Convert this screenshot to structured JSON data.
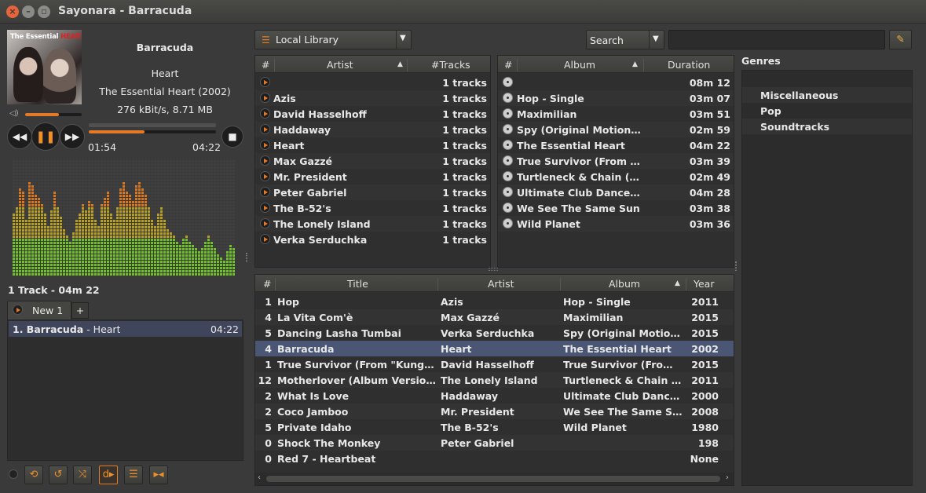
{
  "window": {
    "title": "Sayonara - Barracuda"
  },
  "now_playing": {
    "title": "Barracuda",
    "artist": "Heart",
    "album": "The Essential Heart (2002)",
    "bitrate": "276 kBit/s, 8.71 MB",
    "cover_text": "The Essential",
    "cover_brand": "HEART",
    "elapsed": "01:54",
    "duration": "04:22",
    "progress": 0.44,
    "volume": 0.6
  },
  "playlist": {
    "summary": "1 Track - 04m 22",
    "tab_label": "New 1",
    "add_tab": "+",
    "items": [
      {
        "title": "1. Barracuda",
        "artist": " - Heart",
        "time": "04:22"
      }
    ]
  },
  "library": {
    "source": "Local Library",
    "search_mode": "Search",
    "search_value": "",
    "artist_headers": {
      "num": "#",
      "artist": "Artist",
      "tracks": "#Tracks"
    },
    "artists": [
      {
        "name": "",
        "tracks": "1 tracks"
      },
      {
        "name": "Azis",
        "tracks": "1 tracks"
      },
      {
        "name": "David Hasselhoff",
        "tracks": "1 tracks"
      },
      {
        "name": "Haddaway",
        "tracks": "1 tracks"
      },
      {
        "name": "Heart",
        "tracks": "1 tracks"
      },
      {
        "name": "Max Gazzé",
        "tracks": "1 tracks"
      },
      {
        "name": "Mr. President",
        "tracks": "1 tracks"
      },
      {
        "name": "Peter Gabriel",
        "tracks": "1 tracks"
      },
      {
        "name": "The B-52's",
        "tracks": "1 tracks"
      },
      {
        "name": "The Lonely Island",
        "tracks": "1 tracks"
      },
      {
        "name": "Verka Serduchka",
        "tracks": "1 tracks"
      }
    ],
    "album_headers": {
      "num": "#",
      "album": "Album",
      "duration": "Duration"
    },
    "albums": [
      {
        "name": "",
        "duration": "08m 12"
      },
      {
        "name": "Hop - Single",
        "duration": "03m 07"
      },
      {
        "name": "Maximilian",
        "duration": "03m 51"
      },
      {
        "name": "Spy (Original Motion P...",
        "duration": "02m 59"
      },
      {
        "name": "The Essential Heart",
        "duration": "04m 22"
      },
      {
        "name": "True Survivor (From \"K...",
        "duration": "03m 39"
      },
      {
        "name": "Turtleneck & Chain (Ex...",
        "duration": "02m 49"
      },
      {
        "name": "Ultimate Club Dance 9...",
        "duration": "04m 28"
      },
      {
        "name": "We See The Same Sun",
        "duration": "03m 38"
      },
      {
        "name": "Wild Planet",
        "duration": "03m 36"
      }
    ],
    "genres_title": "Genres",
    "genres": [
      "Miscellaneous",
      "Pop",
      "Soundtracks"
    ],
    "track_headers": {
      "num": "#",
      "title": "Title",
      "artist": "Artist",
      "album": "Album",
      "year": "Year"
    },
    "tracks": [
      {
        "num": "1",
        "title": "Hop",
        "artist": "Azis",
        "album": "Hop - Single",
        "year": "2011"
      },
      {
        "num": "4",
        "title": "La Vita Com'è",
        "artist": "Max Gazzé",
        "album": "Maximilian",
        "year": "2015"
      },
      {
        "num": "5",
        "title": "Dancing Lasha Tumbai",
        "artist": "Verka Serduchka",
        "album": "Spy (Original Motion ...",
        "year": "2015"
      },
      {
        "num": "4",
        "title": "Barracuda",
        "artist": "Heart",
        "album": "The Essential Heart",
        "year": "2002"
      },
      {
        "num": "1",
        "title": "True Survivor (From \"Kung Fur...",
        "artist": "David Hasselhoff",
        "album": "True Survivor (From \"...",
        "year": "2015"
      },
      {
        "num": "12",
        "title": "Motherlover (Album Version) [...",
        "artist": "The Lonely Island",
        "album": "Turtleneck & Chain (E...",
        "year": "2011"
      },
      {
        "num": "2",
        "title": "What Is Love",
        "artist": "Haddaway",
        "album": "Ultimate Club Dance ...",
        "year": "2000"
      },
      {
        "num": "2",
        "title": "Coco Jamboo",
        "artist": "Mr. President",
        "album": "We See The Same Sun",
        "year": "2008"
      },
      {
        "num": "5",
        "title": "Private Idaho",
        "artist": "The B-52's",
        "album": "Wild Planet",
        "year": "1980"
      },
      {
        "num": "0",
        "title": "Shock The Monkey",
        "artist": "Peter Gabriel",
        "album": "",
        "year": "198"
      },
      {
        "num": "0",
        "title": "Red 7 - Heartbeat",
        "artist": "",
        "album": "",
        "year": "None"
      }
    ],
    "selected_track_index": 3
  },
  "colors": {
    "accent": "#e47a25",
    "selection": "#4b5675",
    "close": "#e6643c"
  },
  "spectrum_levels": [
    0.55,
    0.6,
    0.75,
    0.72,
    0.5,
    0.8,
    0.78,
    0.7,
    0.68,
    0.62,
    0.55,
    0.45,
    0.58,
    0.72,
    0.6,
    0.52,
    0.4,
    0.35,
    0.3,
    0.38,
    0.48,
    0.55,
    0.62,
    0.58,
    0.66,
    0.62,
    0.5,
    0.45,
    0.62,
    0.68,
    0.72,
    0.55,
    0.5,
    0.6,
    0.75,
    0.8,
    0.74,
    0.7,
    0.66,
    0.78,
    0.82,
    0.75,
    0.7,
    0.6,
    0.5,
    0.45,
    0.55,
    0.6,
    0.5,
    0.42,
    0.38,
    0.35,
    0.3,
    0.28,
    0.32,
    0.36,
    0.3,
    0.28,
    0.26,
    0.22,
    0.25,
    0.3,
    0.35,
    0.3,
    0.25,
    0.2,
    0.18,
    0.15,
    0.22,
    0.28,
    0.26
  ]
}
